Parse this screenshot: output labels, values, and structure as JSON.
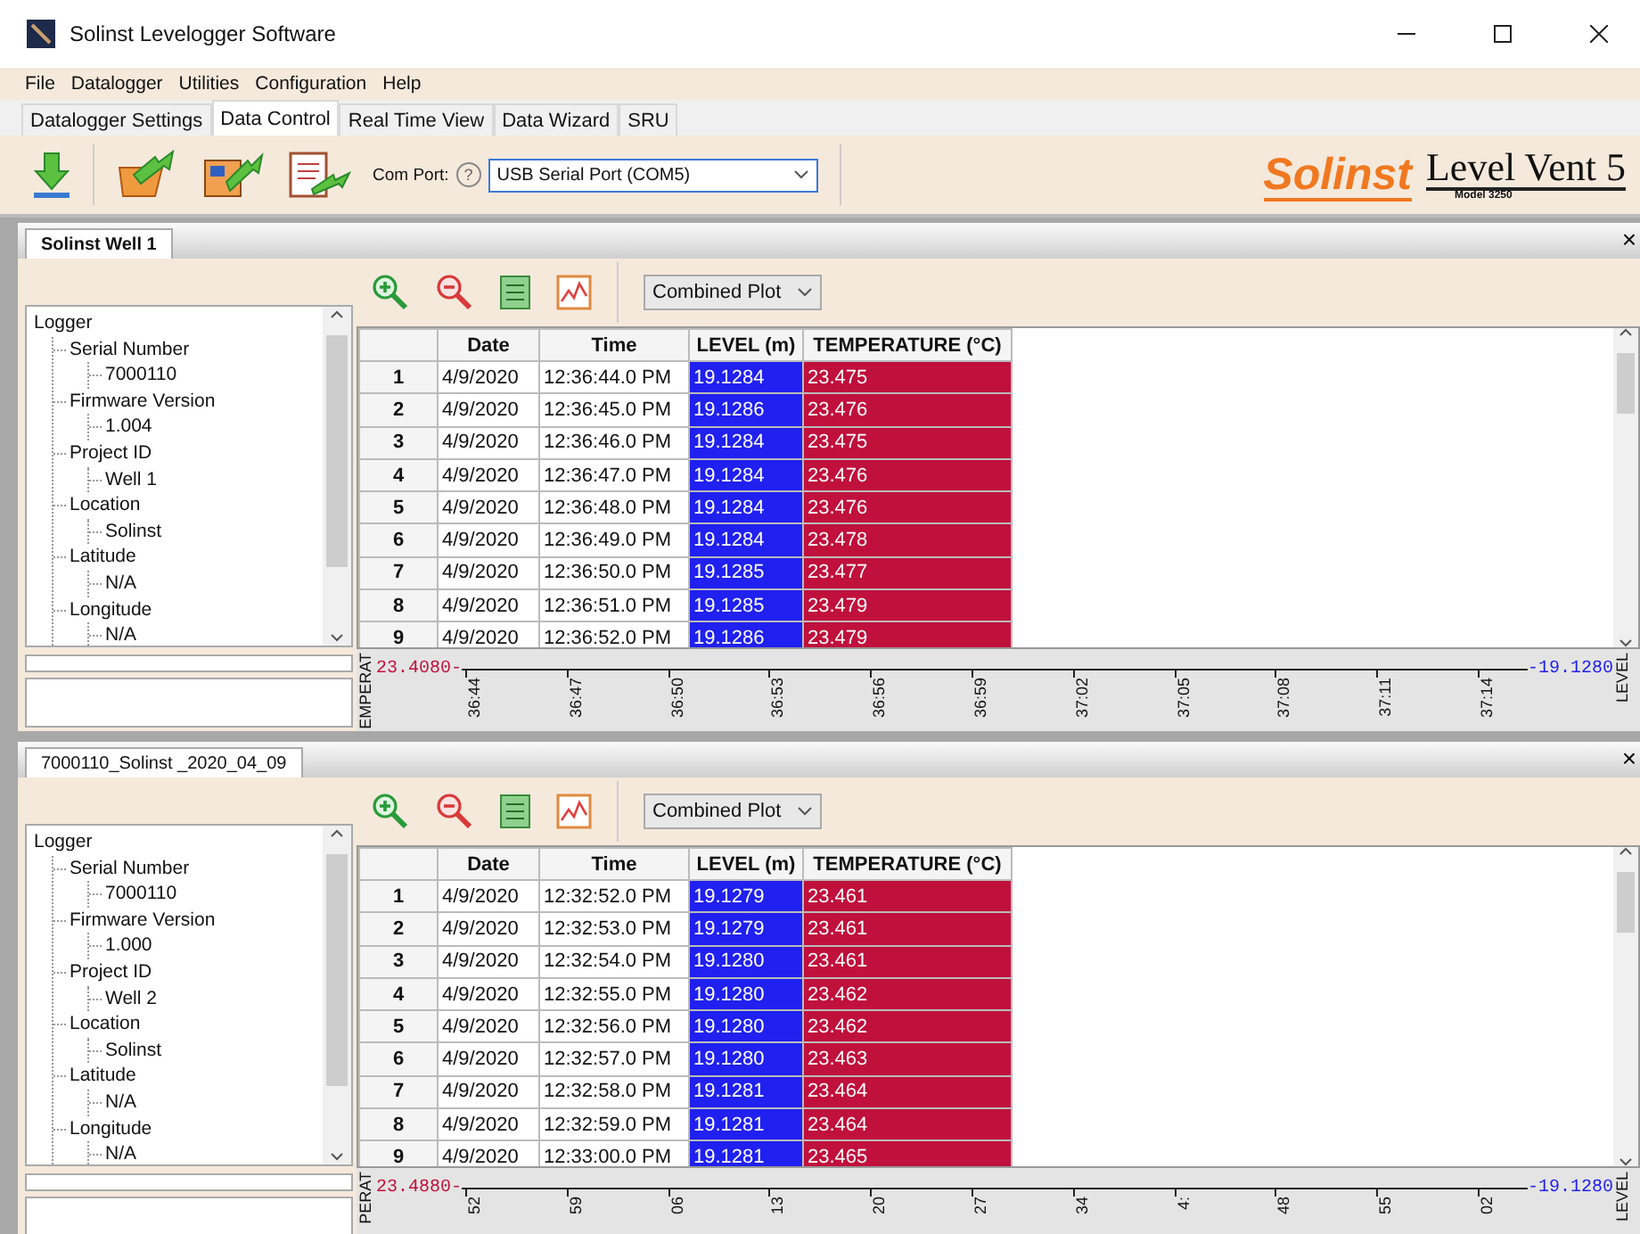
{
  "window": {
    "title": "Solinst Levelogger Software"
  },
  "menu": [
    "File",
    "Datalogger",
    "Utilities",
    "Configuration",
    "Help"
  ],
  "tabs": [
    {
      "label": "Datalogger Settings",
      "selected": false
    },
    {
      "label": "Data Control",
      "selected": true
    },
    {
      "label": "Real Time View",
      "selected": false
    },
    {
      "label": "Data Wizard",
      "selected": false
    },
    {
      "label": "SRU",
      "selected": false
    }
  ],
  "toolbar": {
    "com_port_label": "Com Port:",
    "help": "?",
    "com_port": "USB Serial Port (COM5)"
  },
  "logo": {
    "brand": "Solinst",
    "product": "Level Vent 5",
    "model": "Model 3250"
  },
  "panels": [
    {
      "tab": "Solinst Well 1",
      "close": "×",
      "plot_mode": "Combined Plot",
      "tree": [
        {
          "label": "Logger",
          "children": [
            {
              "label": "Serial Number",
              "children": [
                {
                  "label": "7000110"
                }
              ]
            },
            {
              "label": "Firmware Version",
              "children": [
                {
                  "label": "1.004"
                }
              ]
            },
            {
              "label": "Project ID",
              "children": [
                {
                  "label": "Well 1"
                }
              ]
            },
            {
              "label": "Location",
              "children": [
                {
                  "label": "Solinst"
                }
              ]
            },
            {
              "label": "Latitude",
              "children": [
                {
                  "label": "N/A"
                }
              ]
            },
            {
              "label": "Longitude",
              "children": [
                {
                  "label": "N/A"
                }
              ]
            }
          ]
        }
      ],
      "table": {
        "columns": [
          {},
          {
            "label": "Date"
          },
          {
            "label": "Time"
          },
          {
            "label": "LEVEL (m)",
            "color": "#2020f0"
          },
          {
            "label": "TEMPERATURE (°C)",
            "color": "#c0103c"
          }
        ],
        "rows": [
          [
            "1",
            "4/9/2020",
            "12:36:44.0 PM",
            "19.1284",
            "23.475"
          ],
          [
            "2",
            "4/9/2020",
            "12:36:45.0 PM",
            "19.1286",
            "23.476"
          ],
          [
            "3",
            "4/9/2020",
            "12:36:46.0 PM",
            "19.1284",
            "23.475"
          ],
          [
            "4",
            "4/9/2020",
            "12:36:47.0 PM",
            "19.1284",
            "23.476"
          ],
          [
            "5",
            "4/9/2020",
            "12:36:48.0 PM",
            "19.1284",
            "23.476"
          ],
          [
            "6",
            "4/9/2020",
            "12:36:49.0 PM",
            "19.1284",
            "23.478"
          ],
          [
            "7",
            "4/9/2020",
            "12:36:50.0 PM",
            "19.1285",
            "23.477"
          ],
          [
            "8",
            "4/9/2020",
            "12:36:51.0 PM",
            "19.1285",
            "23.479"
          ],
          [
            "9",
            "4/9/2020",
            "12:36:52.0 PM",
            "19.1286",
            "23.479"
          ]
        ]
      },
      "plot": {
        "left_title": "EMPERAT",
        "left_value": "23.4080-",
        "right_value": "-19.1280",
        "right_title": "LEVEL",
        "x_ticks": [
          "36:44",
          "36:47",
          "36:50",
          "36:53",
          "36:56",
          "36:59",
          "37:02",
          "37:05",
          "37:08",
          "37:11",
          "37:14"
        ]
      }
    },
    {
      "tab": "7000110_Solinst _2020_04_09",
      "close": "×",
      "plot_mode": "Combined Plot",
      "tree": [
        {
          "label": "Logger",
          "children": [
            {
              "label": "Serial Number",
              "children": [
                {
                  "label": "7000110"
                }
              ]
            },
            {
              "label": "Firmware Version",
              "children": [
                {
                  "label": "1.000"
                }
              ]
            },
            {
              "label": "Project ID",
              "children": [
                {
                  "label": "Well 2"
                }
              ]
            },
            {
              "label": "Location",
              "children": [
                {
                  "label": "Solinst"
                }
              ]
            },
            {
              "label": "Latitude",
              "children": [
                {
                  "label": "N/A"
                }
              ]
            },
            {
              "label": "Longitude",
              "children": [
                {
                  "label": "N/A"
                }
              ]
            }
          ]
        }
      ],
      "table": {
        "columns": [
          {},
          {
            "label": "Date"
          },
          {
            "label": "Time"
          },
          {
            "label": "LEVEL (m)",
            "color": "#2020f0"
          },
          {
            "label": "TEMPERATURE (°C)",
            "color": "#c0103c"
          }
        ],
        "rows": [
          [
            "1",
            "4/9/2020",
            "12:32:52.0 PM",
            "19.1279",
            "23.461"
          ],
          [
            "2",
            "4/9/2020",
            "12:32:53.0 PM",
            "19.1279",
            "23.461"
          ],
          [
            "3",
            "4/9/2020",
            "12:32:54.0 PM",
            "19.1280",
            "23.461"
          ],
          [
            "4",
            "4/9/2020",
            "12:32:55.0 PM",
            "19.1280",
            "23.462"
          ],
          [
            "5",
            "4/9/2020",
            "12:32:56.0 PM",
            "19.1280",
            "23.462"
          ],
          [
            "6",
            "4/9/2020",
            "12:32:57.0 PM",
            "19.1280",
            "23.463"
          ],
          [
            "7",
            "4/9/2020",
            "12:32:58.0 PM",
            "19.1281",
            "23.464"
          ],
          [
            "8",
            "4/9/2020",
            "12:32:59.0 PM",
            "19.1281",
            "23.464"
          ],
          [
            "9",
            "4/9/2020",
            "12:33:00.0 PM",
            "19.1281",
            "23.465"
          ]
        ]
      },
      "plot": {
        "left_title": "PERAT",
        "left_value": "23.4880-",
        "right_value": "-19.1280",
        "right_title": "LEVEL",
        "x_ticks": [
          "52",
          "59",
          "06",
          "13",
          "20",
          "27",
          "34",
          "4:",
          "48",
          "55",
          "02"
        ]
      }
    }
  ]
}
